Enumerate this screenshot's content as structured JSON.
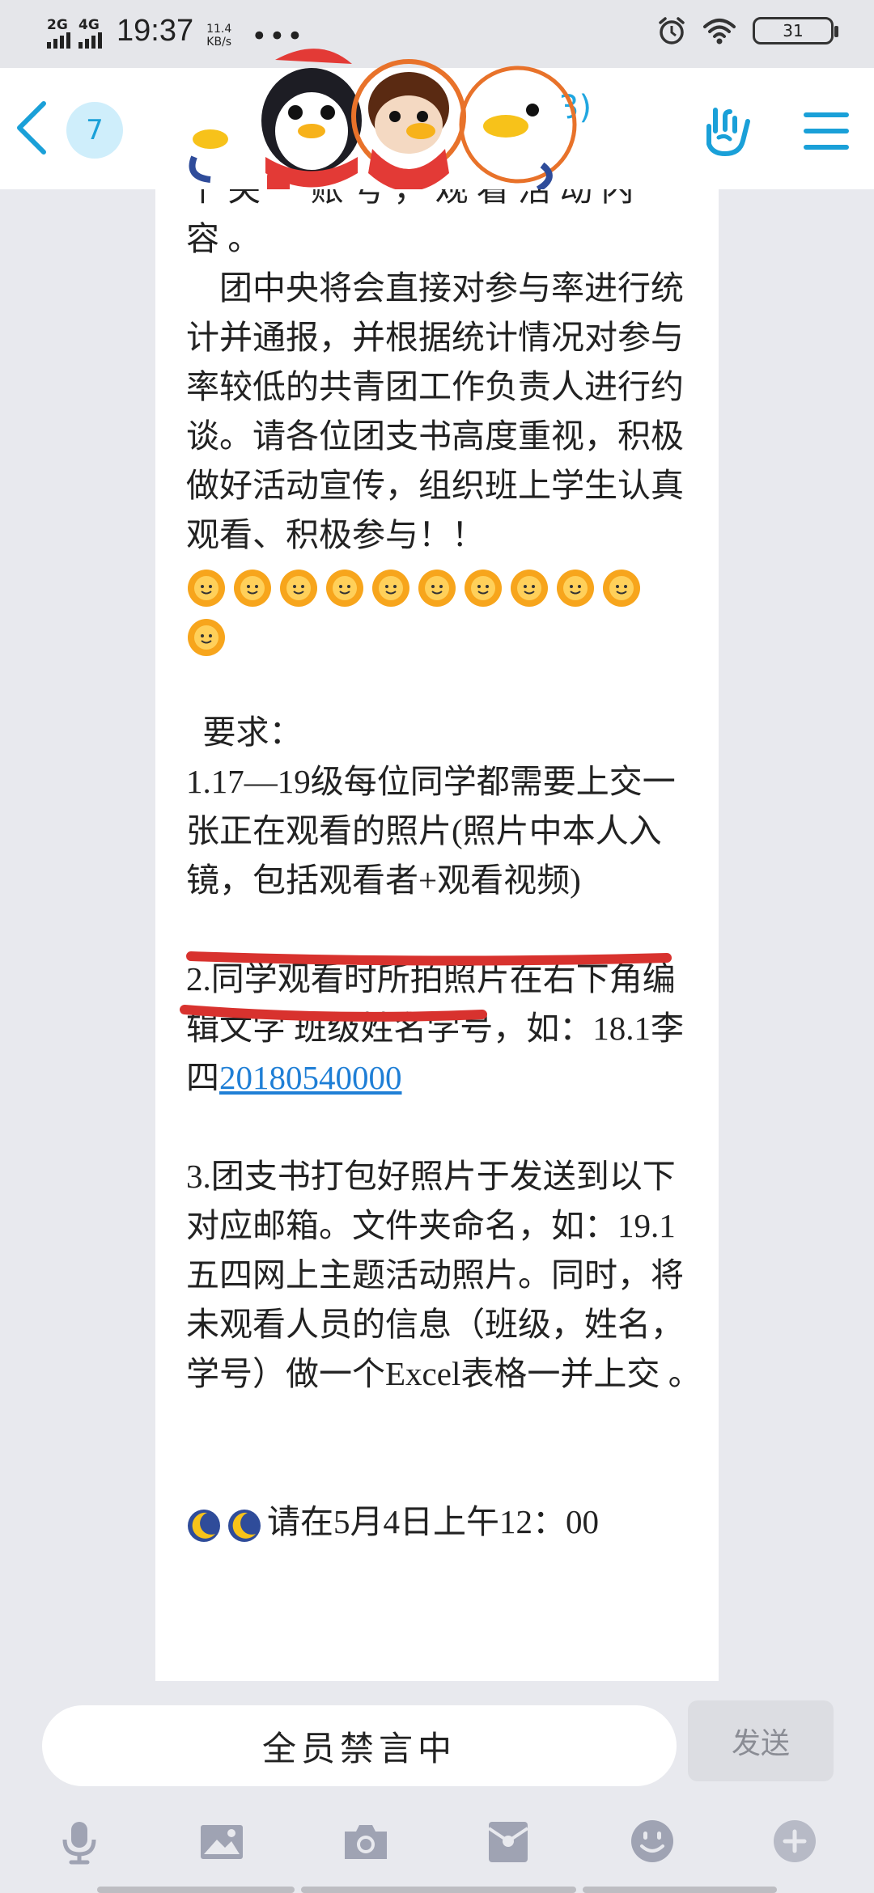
{
  "status_bar": {
    "network1": "2G",
    "network2": "4G",
    "time": "19:37",
    "speed_value": "11.4",
    "speed_unit": "KB/s",
    "more": "•••",
    "battery": "31"
  },
  "header": {
    "unread_count": "7",
    "title_fragment": "3)"
  },
  "message": {
    "line_top": "个 关 一 账 号 ， 观 看 活 动 内\n容 。",
    "para1": "    团中央将会直接对参与率进行统计并通报，并根据统计情况对参与率较低的共青团工作负责人进行约谈。请各位团支书高度重视，积极做好活动宣传，组织班上学生认真观看、积极参与！！",
    "requirements_title": "  要求：",
    "req1": "1.17—19级每位同学都需要上交一张正在观看的照片(照片中本人入镜，包括观看者+观看视频)",
    "req2_text": "2.同学观看时所拍照片在右下角编辑文字 班级姓名学号，如：18.1李四",
    "req2_link": "20180540000",
    "req3": "3.团支书打包好照片于发送到以下对应邮箱。文件夹命名，如：19.1五四网上主题活动照片。同时，将未观看人员的信息（班级，姓名，学号）做一个Excel表格一并上交 。",
    "last_line": "请在5月4日上午12：00"
  },
  "input_bar": {
    "mute_label": "全员禁言中",
    "send_label": "发送"
  },
  "icons": {
    "sun": "sun-emoji",
    "moon": "moon-emoji"
  },
  "colors": {
    "accent": "#1aa0d8",
    "underline": "#d8322e",
    "link": "#1f7fd6"
  }
}
